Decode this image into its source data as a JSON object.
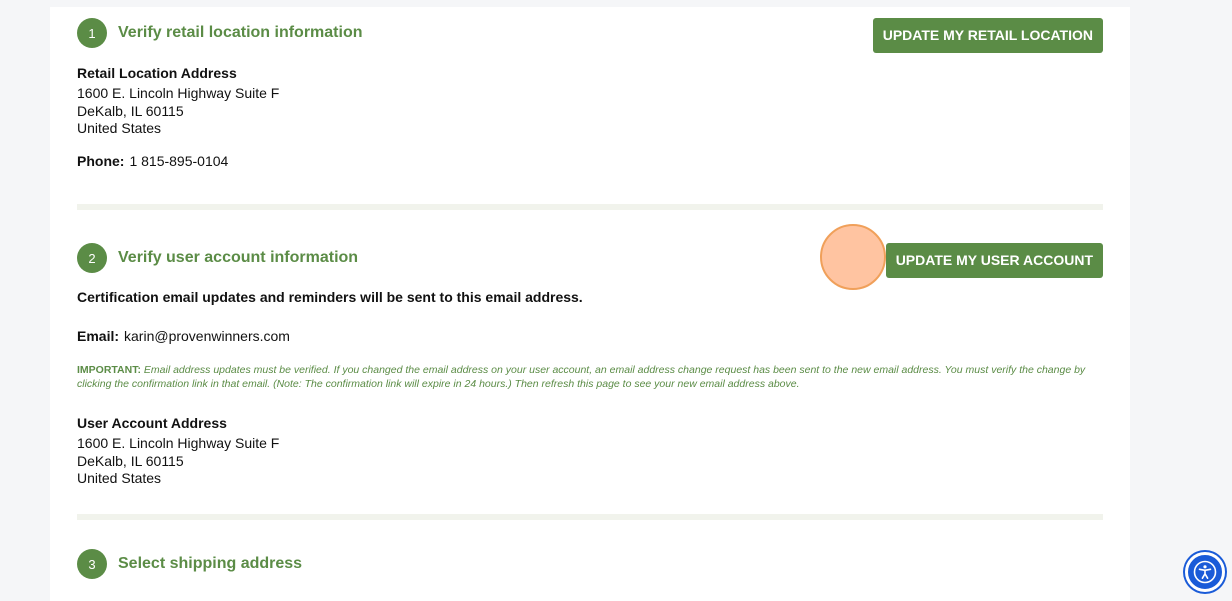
{
  "section1": {
    "number": "1",
    "title": "Verify retail location information",
    "button_label": "UPDATE MY RETAIL LOCATION",
    "address_label": "Retail Location Address",
    "address_lines": [
      "1600 E. Lincoln Highway Suite F",
      "DeKalb, IL 60115",
      "United States"
    ],
    "phone_label": "Phone:",
    "phone_value": "1 815-895-0104"
  },
  "section2": {
    "number": "2",
    "title": "Verify user account information",
    "button_label": "UPDATE MY USER ACCOUNT",
    "cert_notice": "Certification email updates and reminders will be sent to this email address.",
    "email_label": "Email:",
    "email_value": "karin@provenwinners.com",
    "important_label": "IMPORTANT:",
    "important_text": "Email address updates must be verified. If you changed the email address on your user account, an email address change request has been sent to the new email address. You must verify the change by clicking the confirmation link in that email. (Note: The confirmation link will expire in 24 hours.) Then refresh this page to see your new email address above.",
    "address_label": "User Account Address",
    "address_lines": [
      "1600 E. Lincoln Highway Suite F",
      "DeKalb, IL 60115",
      "United States"
    ]
  },
  "section3": {
    "number": "3",
    "title": "Select shipping address"
  },
  "icons": {
    "accessibility": "accessibility-icon"
  },
  "colors": {
    "accent_green": "#5b8c46",
    "accessibility_blue": "#1a5bd8",
    "click_indicator": "#ffb78c"
  }
}
